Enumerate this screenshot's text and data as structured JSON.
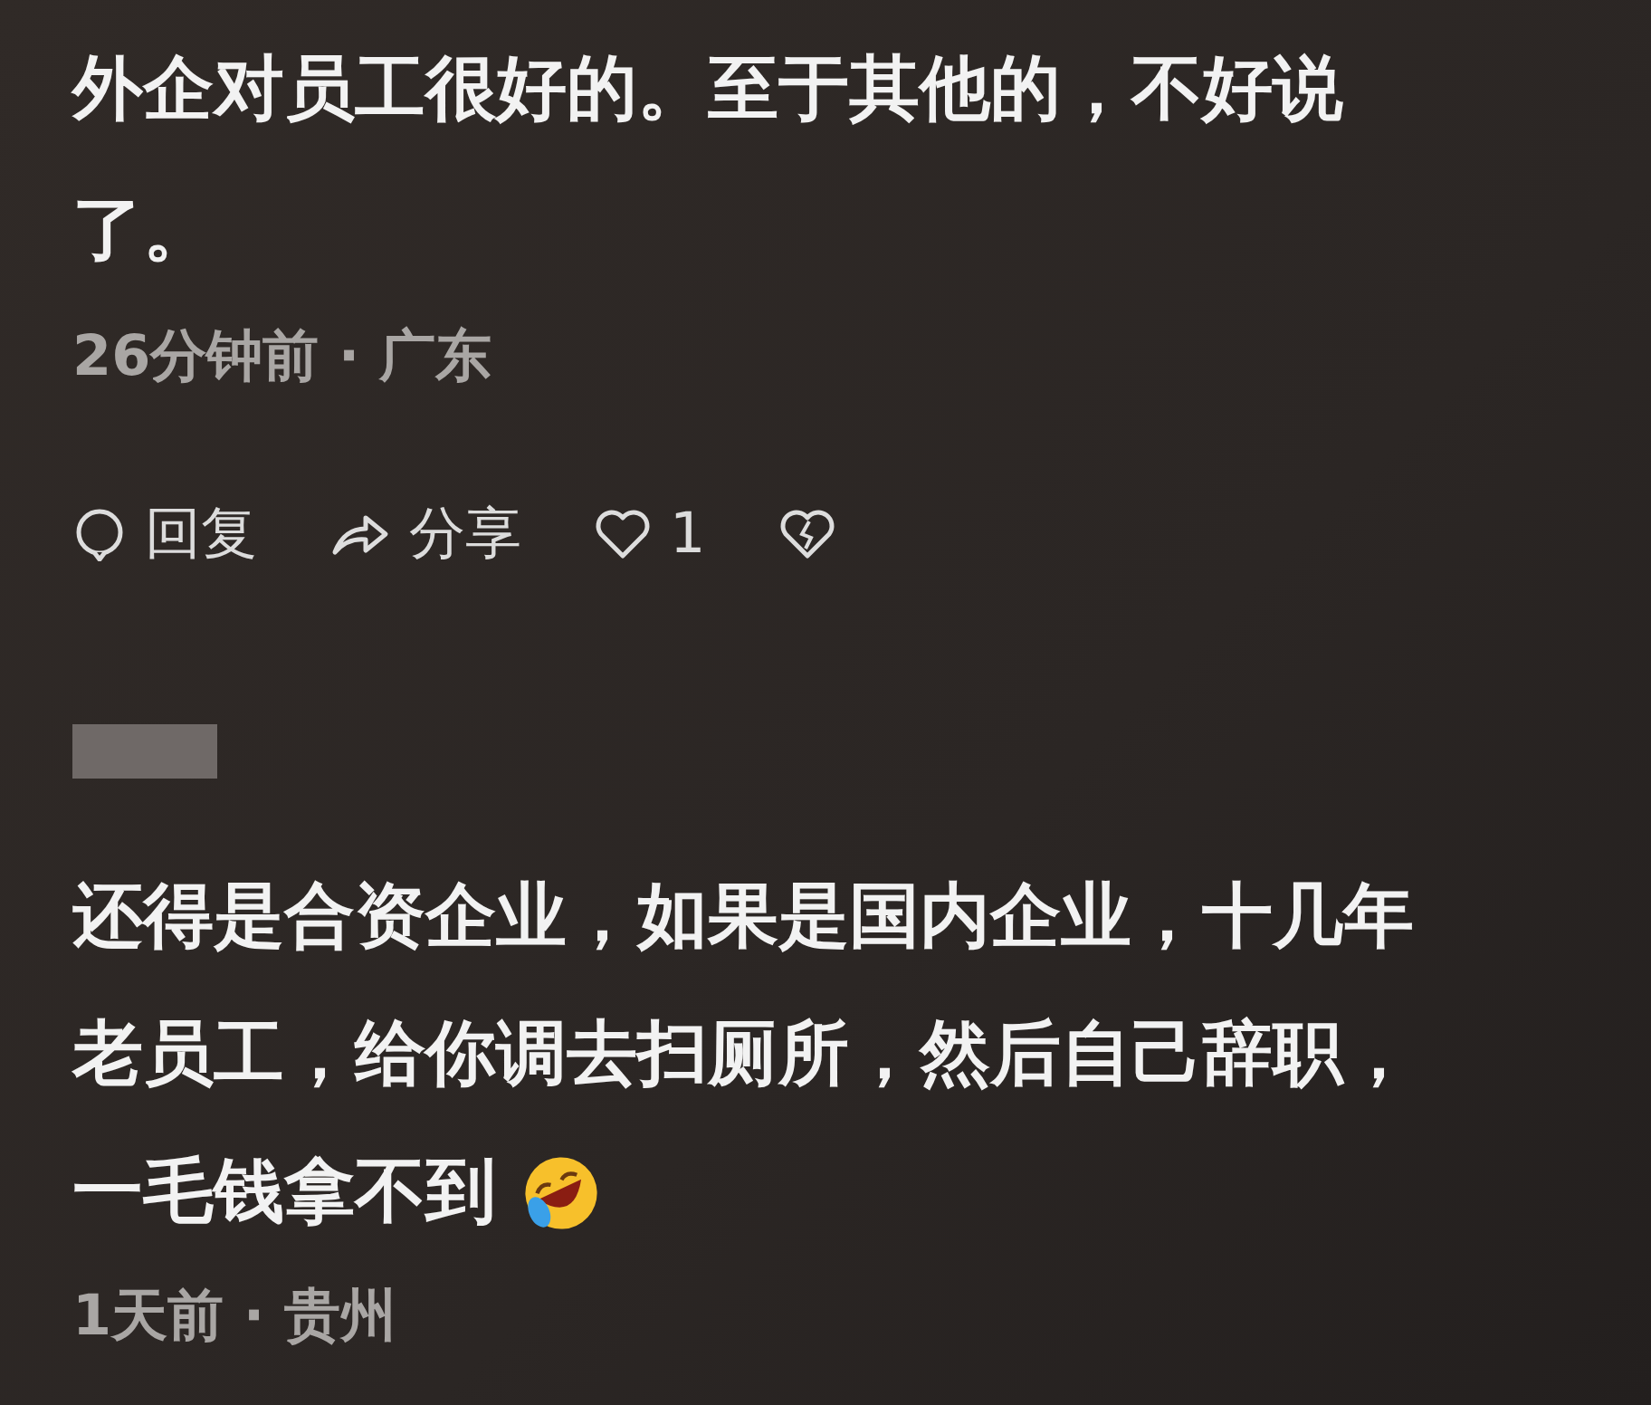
{
  "comments": [
    {
      "lines": [
        "外企对员工很好的。至于其他的，不好说",
        "了。"
      ],
      "time": "26分钟前",
      "separator": "·",
      "location": "广东",
      "actions": {
        "reply": "回复",
        "share": "分享",
        "likes": "1",
        "liked": false
      }
    },
    {
      "author_hidden": true,
      "lines": [
        "还得是合资企业，如果是国内企业，十几年",
        "老员工，给你调去扫厕所，然后自己辞职，",
        "一毛钱拿不到"
      ],
      "emoji": true,
      "time": "1天前",
      "separator": "·",
      "location": "贵州"
    }
  ]
}
